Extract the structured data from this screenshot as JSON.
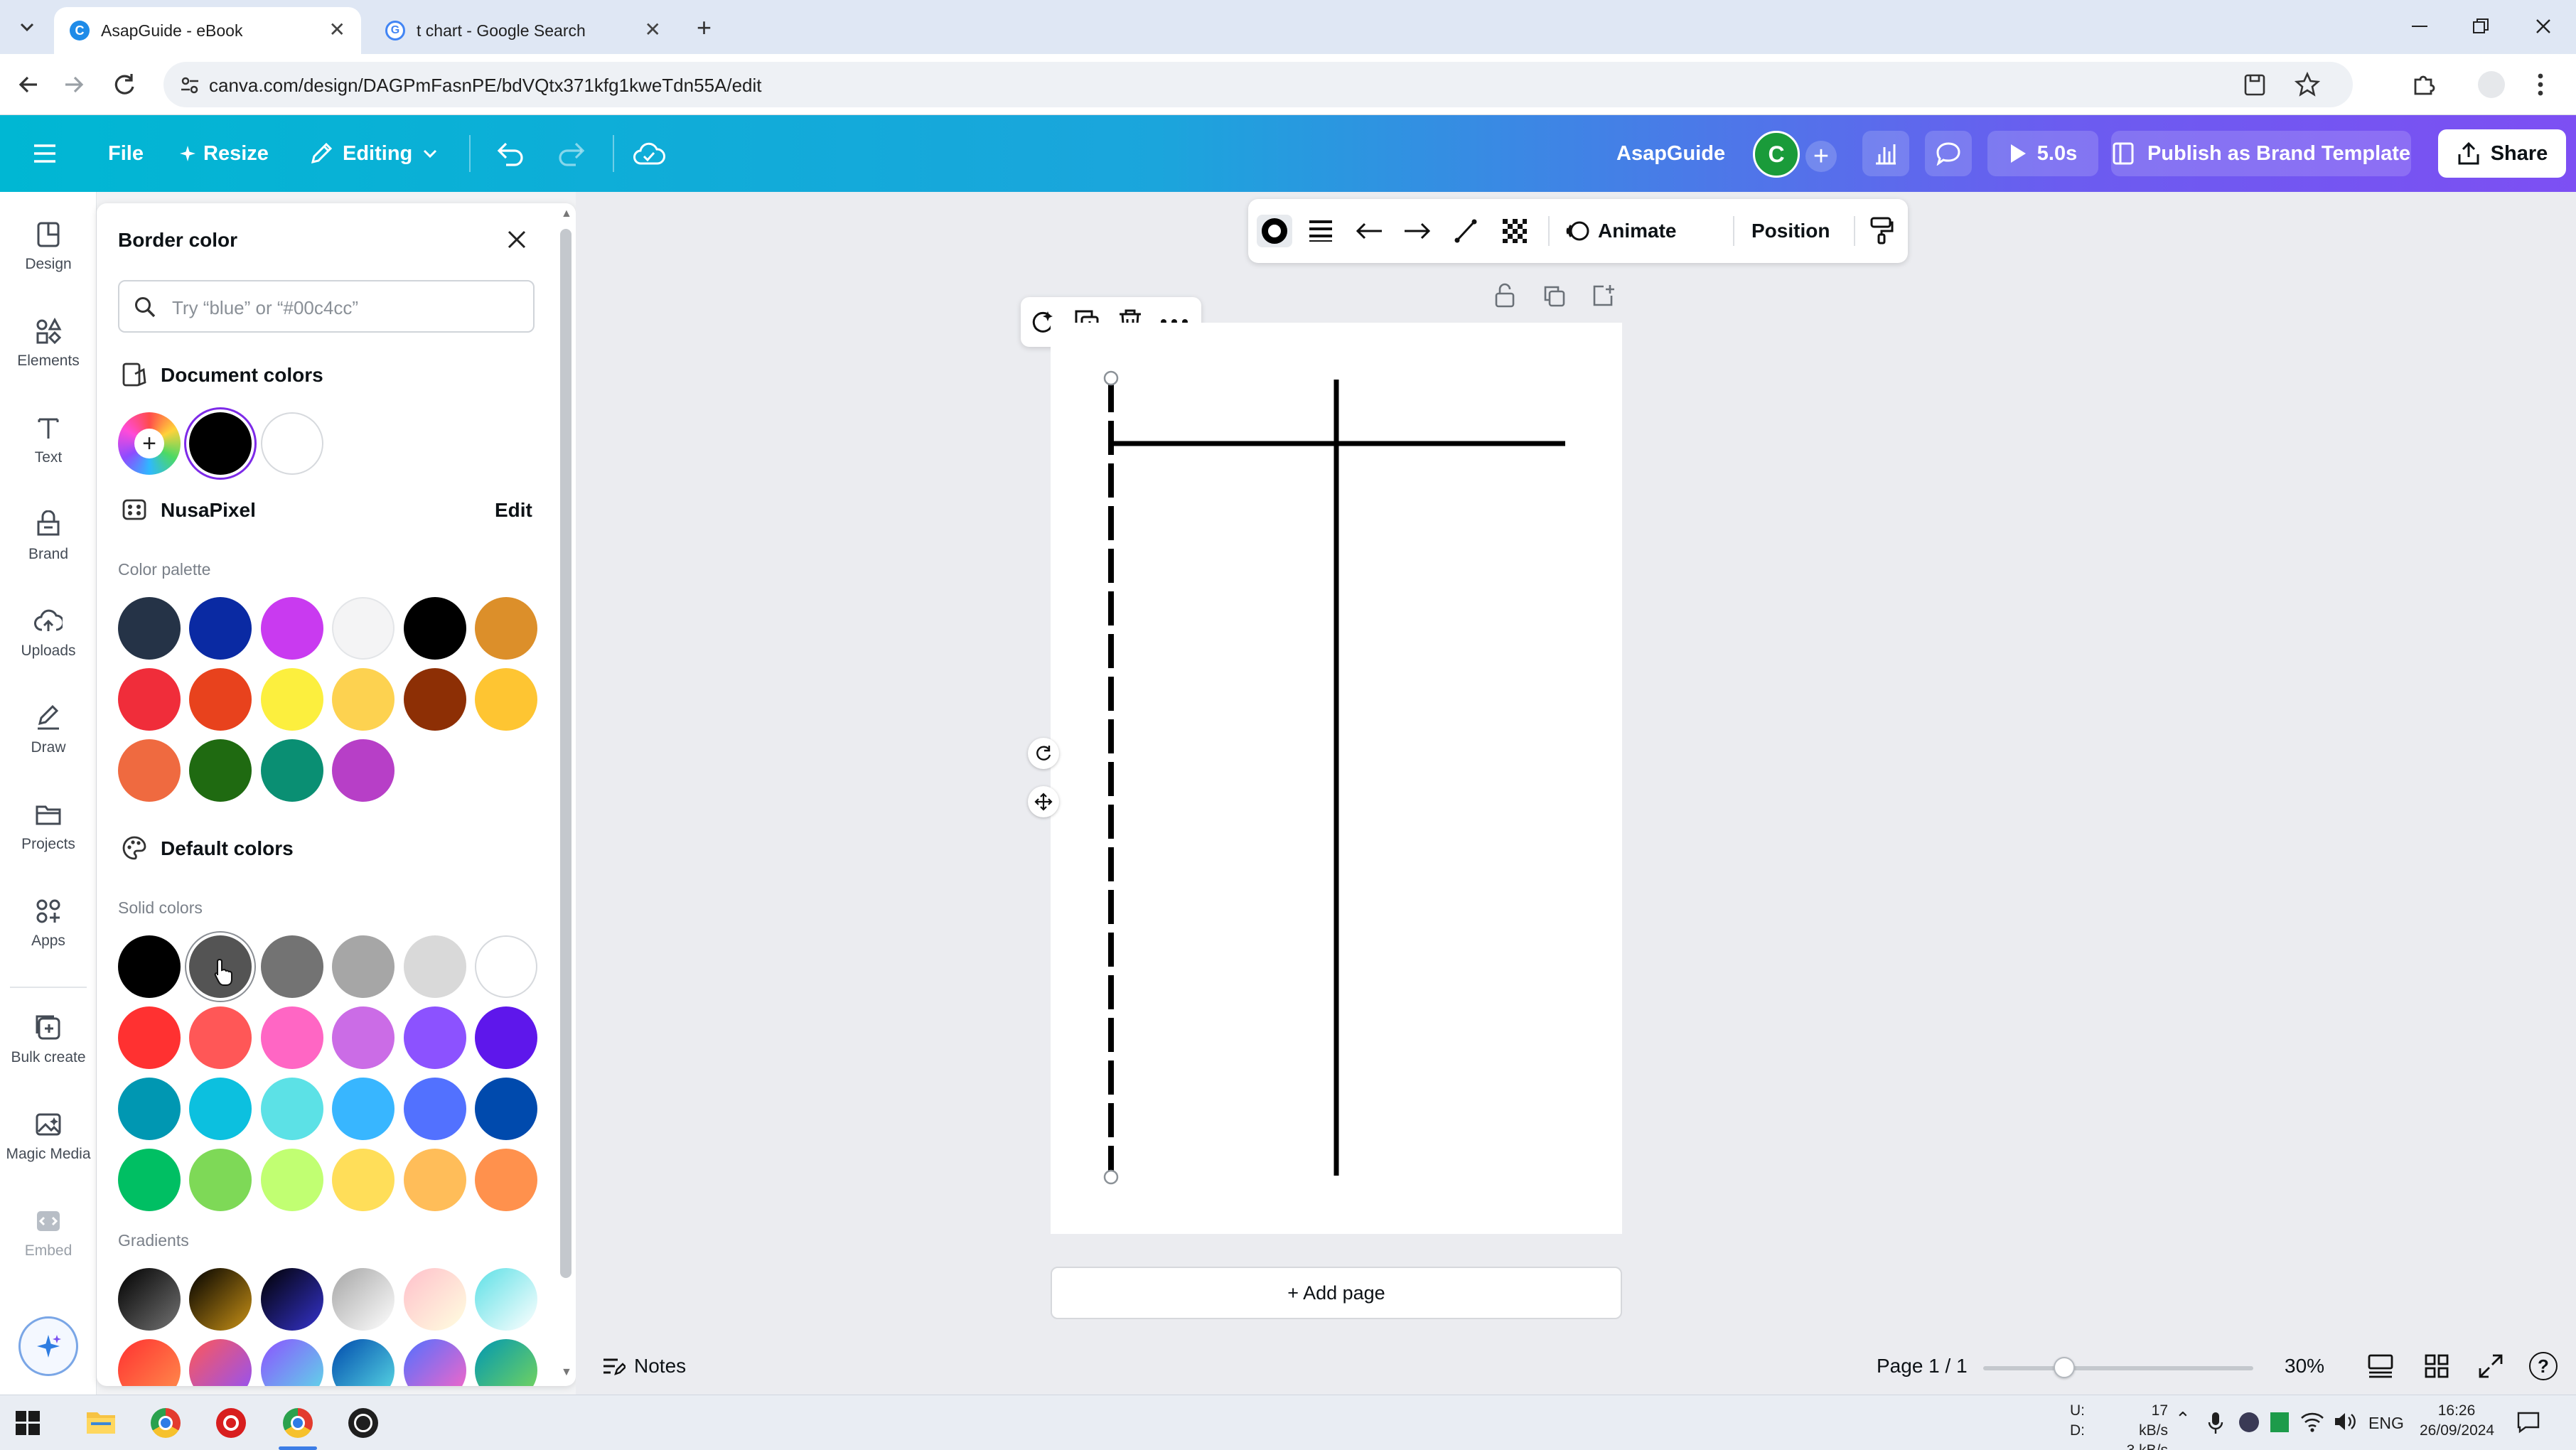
{
  "browser": {
    "tabs": [
      {
        "title": "AsapGuide - eBook",
        "active": true
      },
      {
        "title": "t chart - Google Search",
        "active": false
      }
    ],
    "url": "canva.com/design/DAGPmFasnPE/bdVQtx371kfg1kweTdn55A/edit"
  },
  "header": {
    "file": "File",
    "resize": "Resize",
    "editing": "Editing",
    "design_name": "AsapGuide",
    "avatar_letter": "C",
    "timer": "5.0s",
    "publish": "Publish as Brand Template",
    "share": "Share"
  },
  "rail": {
    "items": [
      "Design",
      "Elements",
      "Text",
      "Brand",
      "Uploads",
      "Draw",
      "Projects",
      "Apps",
      "Bulk create",
      "Magic Media",
      "Embed"
    ]
  },
  "panel": {
    "title": "Border color",
    "search_placeholder": "Try “blue” or “#00c4cc”",
    "document_colors_title": "Document colors",
    "document_colors": [
      "#000000",
      "#ffffff"
    ],
    "brand_name": "NusaPixel",
    "edit_label": "Edit",
    "color_palette_label": "Color palette",
    "palette_colors": [
      "#253347",
      "#0a2aa3",
      "#c93af0",
      "#f4f4f5",
      "#000000",
      "#dc8f2a",
      "#f02d3a",
      "#e8421d",
      "#fcef3e",
      "#fdd250",
      "#8d2f05",
      "#fec532",
      "#ef6a40",
      "#1f6a11",
      "#0a8f73",
      "#b73fc7"
    ],
    "default_colors_title": "Default colors",
    "solid_colors_label": "Solid colors",
    "solid_colors": [
      "#000000",
      "#545454",
      "#737373",
      "#a6a6a6",
      "#d9d9d9",
      "#ffffff",
      "#ff3131",
      "#ff5757",
      "#ff66c4",
      "#cb6ce6",
      "#8c52ff",
      "#5e17eb",
      "#0097b2",
      "#0cc0df",
      "#5ce1e6",
      "#38b6ff",
      "#5271ff",
      "#004aad",
      "#00bf63",
      "#7ed957",
      "#c1ff72",
      "#ffde59",
      "#ffbd59",
      "#ff914d"
    ],
    "gradients_label": "Gradients",
    "gradients": [
      [
        "#000000",
        "#737373"
      ],
      [
        "#000000",
        "#c89116"
      ],
      [
        "#000000",
        "#3533cd"
      ],
      [
        "#a6a6a6",
        "#ffffff"
      ],
      [
        "#ffc0cb",
        "#ffffe0"
      ],
      [
        "#5de0e6",
        "#ffffff"
      ],
      [
        "#ff3131",
        "#ff914d"
      ],
      [
        "#ff5757",
        "#8c52ff"
      ],
      [
        "#8c52ff",
        "#5ce1e6"
      ],
      [
        "#004aad",
        "#5de0e6"
      ],
      [
        "#5170ff",
        "#ff66c4"
      ],
      [
        "#0097b2",
        "#7ed957"
      ]
    ]
  },
  "element_toolbar": {
    "animate": "Animate",
    "position": "Position"
  },
  "canvas": {
    "add_page": "+ Add page"
  },
  "footer": {
    "notes": "Notes",
    "page": "Page 1 / 1",
    "zoom": "30%",
    "zoom_level": 0.3
  },
  "taskbar": {
    "net_up_label": "U:",
    "net_down_label": "D:",
    "net_up": "17 kB/s",
    "net_down": "3 kB/s",
    "lang": "ENG",
    "time": "16:26",
    "date": "26/09/2024"
  }
}
